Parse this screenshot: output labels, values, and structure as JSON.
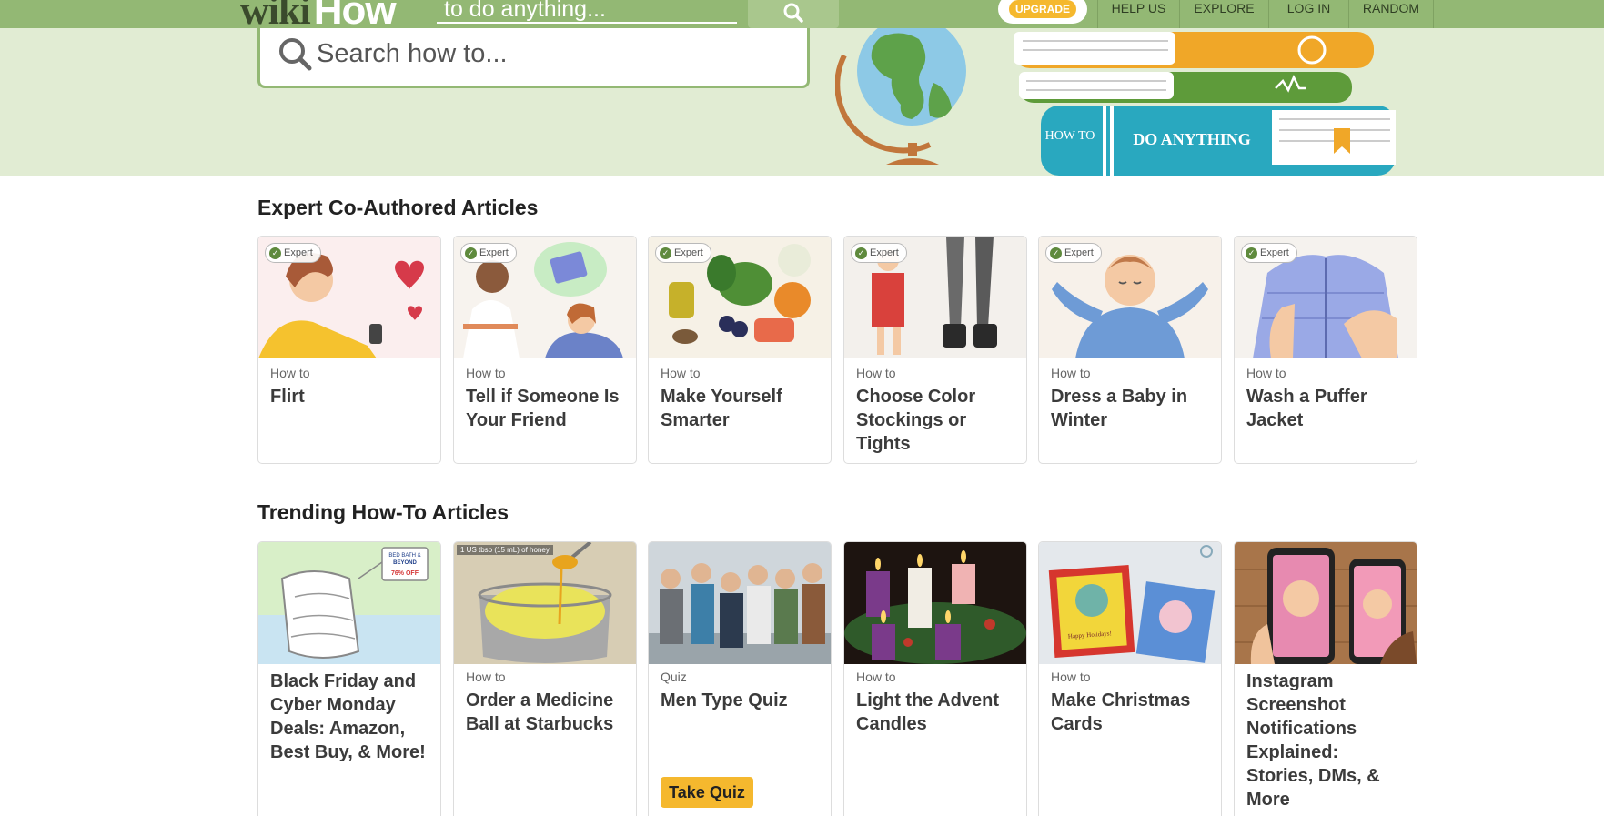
{
  "header": {
    "logo_wiki": "wiki",
    "logo_how": "How",
    "search_placeholder": "to do anything...",
    "upgrade_label": "UPGRADE",
    "nav": [
      "HELP US",
      "EXPLORE",
      "LOG IN",
      "RANDOM"
    ]
  },
  "hero": {
    "search_placeholder": "Search how to...",
    "book_how_to": "HOW TO",
    "book_title": "DO ANYTHING"
  },
  "expert_section": {
    "title": "Expert Co-Authored Articles",
    "badge_label": "Expert",
    "cards": [
      {
        "kicker": "How to",
        "title": "Flirt",
        "thumb_icon": "woman-texting-hearts-image"
      },
      {
        "kicker": "How to",
        "title": "Tell if Someone Is Your Friend",
        "thumb_icon": "friends-math-book-image"
      },
      {
        "kicker": "How to",
        "title": "Make Yourself Smarter",
        "thumb_icon": "healthy-food-image"
      },
      {
        "kicker": "How to",
        "title": "Choose Color Stockings or Tights",
        "thumb_icon": "stockings-legs-image"
      },
      {
        "kicker": "How to",
        "title": "Dress a Baby in Winter",
        "thumb_icon": "sleeping-baby-image"
      },
      {
        "kicker": "How to",
        "title": "Wash a Puffer Jacket",
        "thumb_icon": "puffer-jacket-image"
      }
    ]
  },
  "trending_section": {
    "title": "Trending How-To Articles",
    "cards": [
      {
        "kicker": "",
        "title": "Black Friday and Cyber Monday Deals: Amazon, Best Buy, & More!",
        "thumb_icon": "towels-price-tag-image",
        "tag_line1": "BED BATH &",
        "tag_line2": "BEYOND",
        "tag_line3": "76% OFF"
      },
      {
        "kicker": "How to",
        "title": "Order a Medicine Ball at Starbucks",
        "thumb_icon": "honey-spoon-image",
        "caption": "1 US tbsp (15 mL) of honey"
      },
      {
        "kicker": "Quiz",
        "title": "Men Type Quiz",
        "thumb_icon": "group-of-men-image",
        "button": "Take Quiz"
      },
      {
        "kicker": "How to",
        "title": "Light the Advent Candles",
        "thumb_icon": "advent-candles-image"
      },
      {
        "kicker": "How to",
        "title": "Make Christmas Cards",
        "thumb_icon": "christmas-cards-image",
        "card_text": "Happy Holidays!"
      },
      {
        "kicker": "",
        "title": "Instagram Screenshot Notifications Explained: Stories, DMs, & More",
        "thumb_icon": "phones-instagram-image"
      }
    ]
  },
  "colors": {
    "brand_green": "#93b874",
    "hero_bg": "#e1ecd3",
    "accent_yellow": "#f5b82e"
  }
}
